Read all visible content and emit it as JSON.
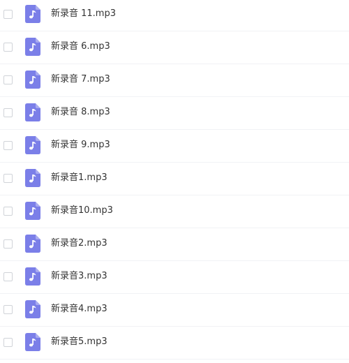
{
  "icon_color": "#7b7fe8",
  "icon_name": "music-file-icon",
  "files": [
    {
      "name": "新录音 11.mp3"
    },
    {
      "name": "新录音 6.mp3"
    },
    {
      "name": "新录音 7.mp3"
    },
    {
      "name": "新录音 8.mp3"
    },
    {
      "name": "新录音 9.mp3"
    },
    {
      "name": "新录音1.mp3"
    },
    {
      "name": "新录音10.mp3"
    },
    {
      "name": "新录音2.mp3"
    },
    {
      "name": "新录音3.mp3"
    },
    {
      "name": "新录音4.mp3"
    },
    {
      "name": "新录音5.mp3"
    }
  ]
}
